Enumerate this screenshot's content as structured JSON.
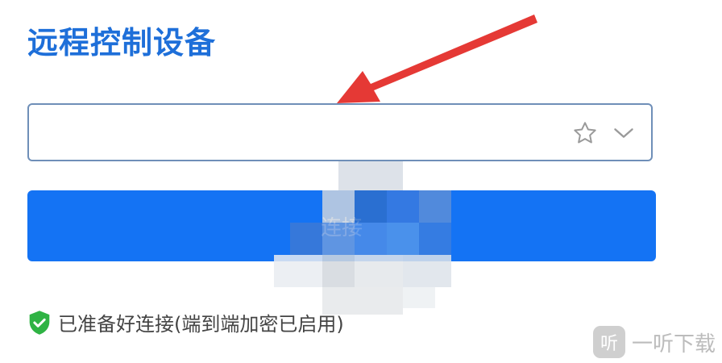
{
  "page": {
    "title": "远程控制设备"
  },
  "device_input": {
    "value": "",
    "placeholder": "",
    "favorite_icon": "star-outline-icon",
    "dropdown_icon": "chevron-down-icon"
  },
  "connect_button": {
    "label": "连接"
  },
  "status": {
    "icon": "shield-check-icon",
    "text": "已准备好连接(端到端加密已启用)"
  },
  "watermark": {
    "logo": "听",
    "text": "一听下载"
  },
  "colors": {
    "title": "#1e6fd9",
    "button": "#1473f4",
    "shield": "#2fb344",
    "arrow": "#e53935"
  }
}
